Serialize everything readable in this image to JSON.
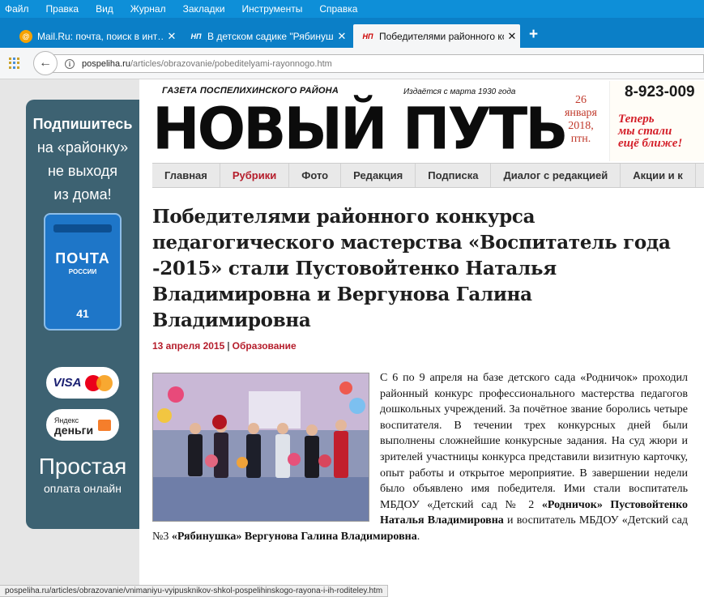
{
  "browser": {
    "menu": [
      "Файл",
      "Правка",
      "Вид",
      "Журнал",
      "Закладки",
      "Инструменты",
      "Справка"
    ],
    "tabs": [
      {
        "title": "Mail.Ru: почта, поиск в инт…",
        "favicon": "mailru-icon",
        "active": false
      },
      {
        "title": "В детском садике \"Рябинуш…",
        "favicon": "newspaper-np-icon",
        "favicon_text": "НП",
        "active": false
      },
      {
        "title": "Победителями районного ко…",
        "favicon": "newspaper-np-icon",
        "favicon_text": "НП",
        "active": true
      }
    ],
    "close_glyph": "✕",
    "new_tab_glyph": "+",
    "back_glyph": "←",
    "url_host": "pospeliha.ru",
    "url_path": "/articles/obrazovanie/pobeditelyami-rayonnogo.htm",
    "status_url": "pospeliha.ru/articles/obrazovanie/vnimaniyu-vyipusknikov-shkol-pospelihinskogo-rayona-i-ih-roditeley.htm",
    "colors": {
      "menubar": "#0e8fd8",
      "tabbar": "#0b7fc7"
    }
  },
  "banner": {
    "line1": "Подпишитесь",
    "line2": "на «районку»",
    "line3": "не выходя",
    "line4": "из дома!",
    "mailbox_word": "ПОЧТА",
    "mailbox_sub": "РОССИИ",
    "mailbox_number": "41",
    "visa_label": "VISA",
    "yandex_line1": "Яндекс",
    "yandex_line2": "деньги",
    "footer_big": "Простая",
    "footer_small": "оплата онлайн",
    "color": "#3d6272"
  },
  "masthead": {
    "tagline": "ГАЗЕТА ПОСПЕЛИХИНСКОГО РАЙОНА",
    "since": "Издаётся с марта 1930 года",
    "title": "НОВЫЙ ПУТЬ",
    "date_day": "26",
    "date_month": "января",
    "date_year": "2018,",
    "date_weekday": "птн.",
    "phone": "8-923-009",
    "slogan_line1": "Теперь",
    "slogan_line2": "мы стали",
    "slogan_line3": "ещё ближе!"
  },
  "nav": {
    "items": [
      "Главная",
      "Рубрики",
      "Фото",
      "Редакция",
      "Подписка",
      "Диалог с редакцией",
      "Акции и к"
    ],
    "active_index": 1,
    "active_color": "#b51d2b"
  },
  "article": {
    "headline": "Победителями районного конкурса педагогического мастерства «Воспитатель года -2015» стали Пустовойтенко Наталья Владимировна и Вергунова Галина Владимировна",
    "date": "13 апреля 2015",
    "separator": "|",
    "category": "Образование",
    "body_intro": "С 6 по 9 апреля на базе детского сада «Родничок» проходил районный конкурс профессионального мастерства педагогов дошкольных учреждений. За почётное звание боролись четыре воспитателя. В течении трех  конкурсных дней были выполнены сложнейшие конкурсные задания. На суд жюри и зрителей участницы конкурса представили визитную карточку, опыт работы и открытое мероприятие. В завершении недели было объявлено имя победителя. Ими стали воспитатель МБДОУ «Детский сад № 2 ",
    "bold1": "«Родничок» Пустовойтенко Наталья Владимировна",
    "middle": " и воспитатель МБДОУ «Детский сад №3 ",
    "bold2": "«Рябинушка» Вергунова Галина Владимировна",
    "end": "."
  }
}
